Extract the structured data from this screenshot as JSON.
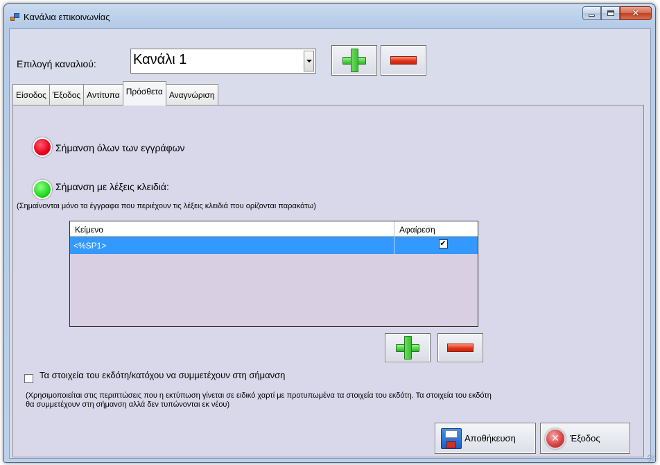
{
  "window": {
    "title": "Κανάλια επικοινωνίας",
    "controls": {
      "minimize": "minimize-icon",
      "maximize": "maximize-icon",
      "close": "✕"
    }
  },
  "channel": {
    "label": "Επιλογή καναλιού:",
    "selected": "Κανάλι 1"
  },
  "tabs": [
    {
      "label": "Είσοδος"
    },
    {
      "label": "Έξοδος"
    },
    {
      "label": "Αντίτυπα"
    },
    {
      "label": "Πρόσθετα",
      "active": true
    },
    {
      "label": "Αναγνώριση"
    }
  ],
  "options": {
    "mark_all": "Σήμανση όλων των εγγράφων",
    "mark_keywords": "Σήμανση με λέξεις κλειδιά:",
    "keywords_hint": "(Σημαίνονται μόνο τα έγγραφα που περιέχουν τις λέξεις κλειδιά που ορίζονται παρακάτω)"
  },
  "grid": {
    "columns": [
      "Κείμενο",
      "Αφαίρεση"
    ],
    "rows": [
      {
        "text": "<%SP1>",
        "remove": true
      }
    ]
  },
  "issuer": {
    "checkbox_label": "Τα στοιχεία του εκδότη/κατόχου να συμμετέχουν στη σήμανση",
    "checked": false,
    "note_line1": "(Χρησιμοποιείται στις περιπτώσεις που η εκτύπωση γίνεται σε ειδικό χαρτί με προτυπωμένα τα στοιχεία του εκδότη. Τα στοιχεία του εκδότη",
    "note_line2": "θα συμμετέχουν στη σήμανση αλλά δεν τυπώνονται εκ νέου)"
  },
  "buttons": {
    "save": "Αποθήκευση",
    "exit": "Έξοδος"
  },
  "colors": {
    "selection": "#3399ff",
    "panel": "#d8d8ea",
    "led_red": "#e8001e",
    "led_green": "#24d81d"
  }
}
